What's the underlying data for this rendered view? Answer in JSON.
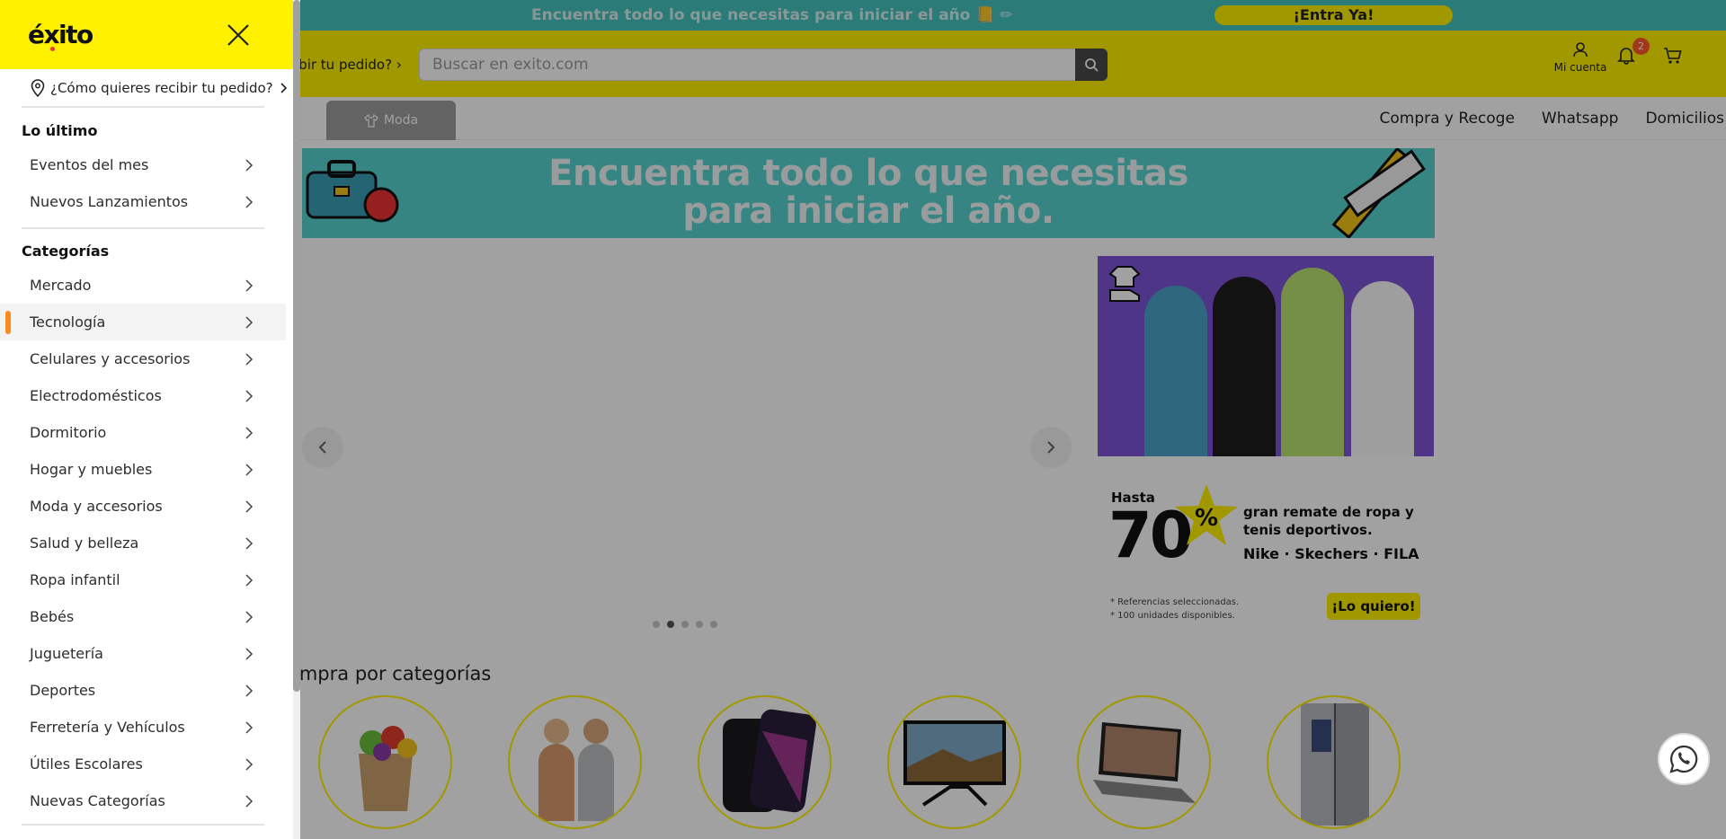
{
  "promo_bar": {
    "text": "Encuentra todo lo que necesitas para iniciar el año 📒 ✏",
    "cta": "¡Entra Ya!"
  },
  "header": {
    "delivery_prompt": "ibir tu pedido?",
    "search_placeholder": "Buscar en exito.com",
    "account_label": "Mi cuenta",
    "notification_count": "2"
  },
  "navbar": {
    "active_tab": "Moda",
    "links": [
      "Compra y Recoge",
      "Whatsapp",
      "Domicilios"
    ]
  },
  "banner": {
    "line1": "Encuentra todo lo que necesitas",
    "line2": "para iniciar el año."
  },
  "carousel": {
    "slide_count": 5,
    "active_index": 1
  },
  "side_promo": {
    "hasta": "Hasta",
    "percent": "70",
    "percent_sign": "%",
    "description": "gran remate de ropa y tenis deportivos.",
    "brands": "Nike · Skechers · FILA",
    "fine_print_1": "* Referencias seleccionadas.",
    "fine_print_2": "* 100 unidades disponibles.",
    "button": "¡Lo quiero!"
  },
  "categories_section": {
    "title": "ompra por categorías"
  },
  "drawer": {
    "logo": "éxito",
    "delivery_question": "¿Cómo quieres recibir tu pedido?",
    "latest_title": "Lo último",
    "latest_items": [
      {
        "label": "Eventos del mes"
      },
      {
        "label": "Nuevos Lanzamientos"
      }
    ],
    "categories_title": "Categorías",
    "categories": [
      {
        "label": "Mercado"
      },
      {
        "label": "Tecnología"
      },
      {
        "label": "Celulares y accesorios"
      },
      {
        "label": "Electrodomésticos"
      },
      {
        "label": "Dormitorio"
      },
      {
        "label": "Hogar y muebles"
      },
      {
        "label": "Moda y accesorios"
      },
      {
        "label": "Salud y belleza"
      },
      {
        "label": "Ropa infantil"
      },
      {
        "label": "Bebés"
      },
      {
        "label": "Juguetería"
      },
      {
        "label": "Deportes"
      },
      {
        "label": "Ferretería y Vehículos"
      },
      {
        "label": "Útiles Escolares"
      },
      {
        "label": "Nuevas Categorías"
      }
    ],
    "active_category": "Tecnología"
  },
  "colors": {
    "brand_yellow": "#fff100",
    "promo_teal": "#45c4c0",
    "active_accent": "#f68b1f",
    "overlay": "rgba(0,0,0,0.37)"
  }
}
